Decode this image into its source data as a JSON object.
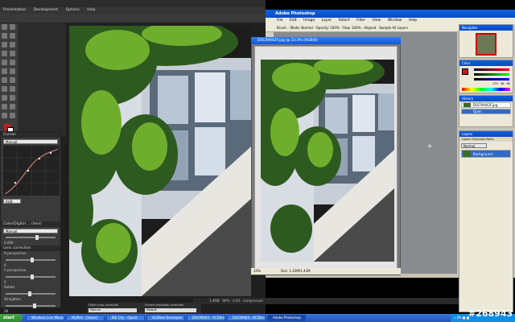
{
  "bg_app": {
    "menu": [
      "Presentation",
      "Development",
      "Options",
      "Help"
    ]
  },
  "curves_panel": {
    "header": "Curves",
    "mode_select": "Manual",
    "channel_select": "RGB",
    "section_color": "Color/Digital ... (lens)",
    "section_lens": "Lens correction",
    "mode_select_2": "Manual",
    "label_h_perspective": "H perspective",
    "label_v_perspective": "V perspective",
    "label_rotate": "Rotate",
    "label_straighten": "Straighten",
    "value_1": "0.000",
    "value_2": "0",
    "value_3": "0",
    "value_4": "28"
  },
  "photoshop": {
    "title": "Adobe Photoshop",
    "menu": [
      "File",
      "Edit",
      "Image",
      "Layer",
      "Select",
      "Filter",
      "View",
      "Window",
      "Help"
    ],
    "options_bar": "Brush:  ·  Mode: Normal  ·  Opacity: 100%  ·  Flow: 100%  ·  Aligned  ·  Sample All Layers",
    "document": {
      "title": "DSC09442F.jpg @ 33.3% (RGB/8)",
      "status_zoom": "33%",
      "status_doc": "Doc: 1.41M/1.41M"
    }
  },
  "panels": {
    "navigator": {
      "header": "Navigator"
    },
    "color": {
      "header": "Color",
      "values": [
        "237",
        "98",
        "80"
      ]
    },
    "history": {
      "header": "History",
      "items": [
        "DSC09442F.jpg",
        "Open"
      ]
    },
    "layers": {
      "header": "Layers",
      "tabs": "Layers  Channels  Paths",
      "blend_mode": "Normal",
      "layer_name": "Background"
    }
  },
  "status_bar": {
    "text": "1.4MB  ·  99%  ·  0.00  ·  Compressed"
  },
  "mini_panels": {
    "left": "Flash cross controller",
    "right": "Screen resolution controller",
    "left_select": "Manual",
    "right_select": "Default"
  },
  "taskbar": {
    "start": "start",
    "tasks": [
      "Windows Live Messenger",
      "MyMail - [Inbox]",
      "IKE City - Opera",
      "ACDSee Developer",
      "DSC09442 - ACDSee Pro 2",
      "DSC09442 - ACDSee 10",
      "Adobe Photoshop"
    ],
    "tray_text": "«  EN  ■  ■"
  },
  "watermark": "#268943",
  "colors": {
    "xp_blue": "#1f55c2",
    "foreground_swatch": "#c0201c",
    "photoshop_title": "#0a4ac8"
  }
}
